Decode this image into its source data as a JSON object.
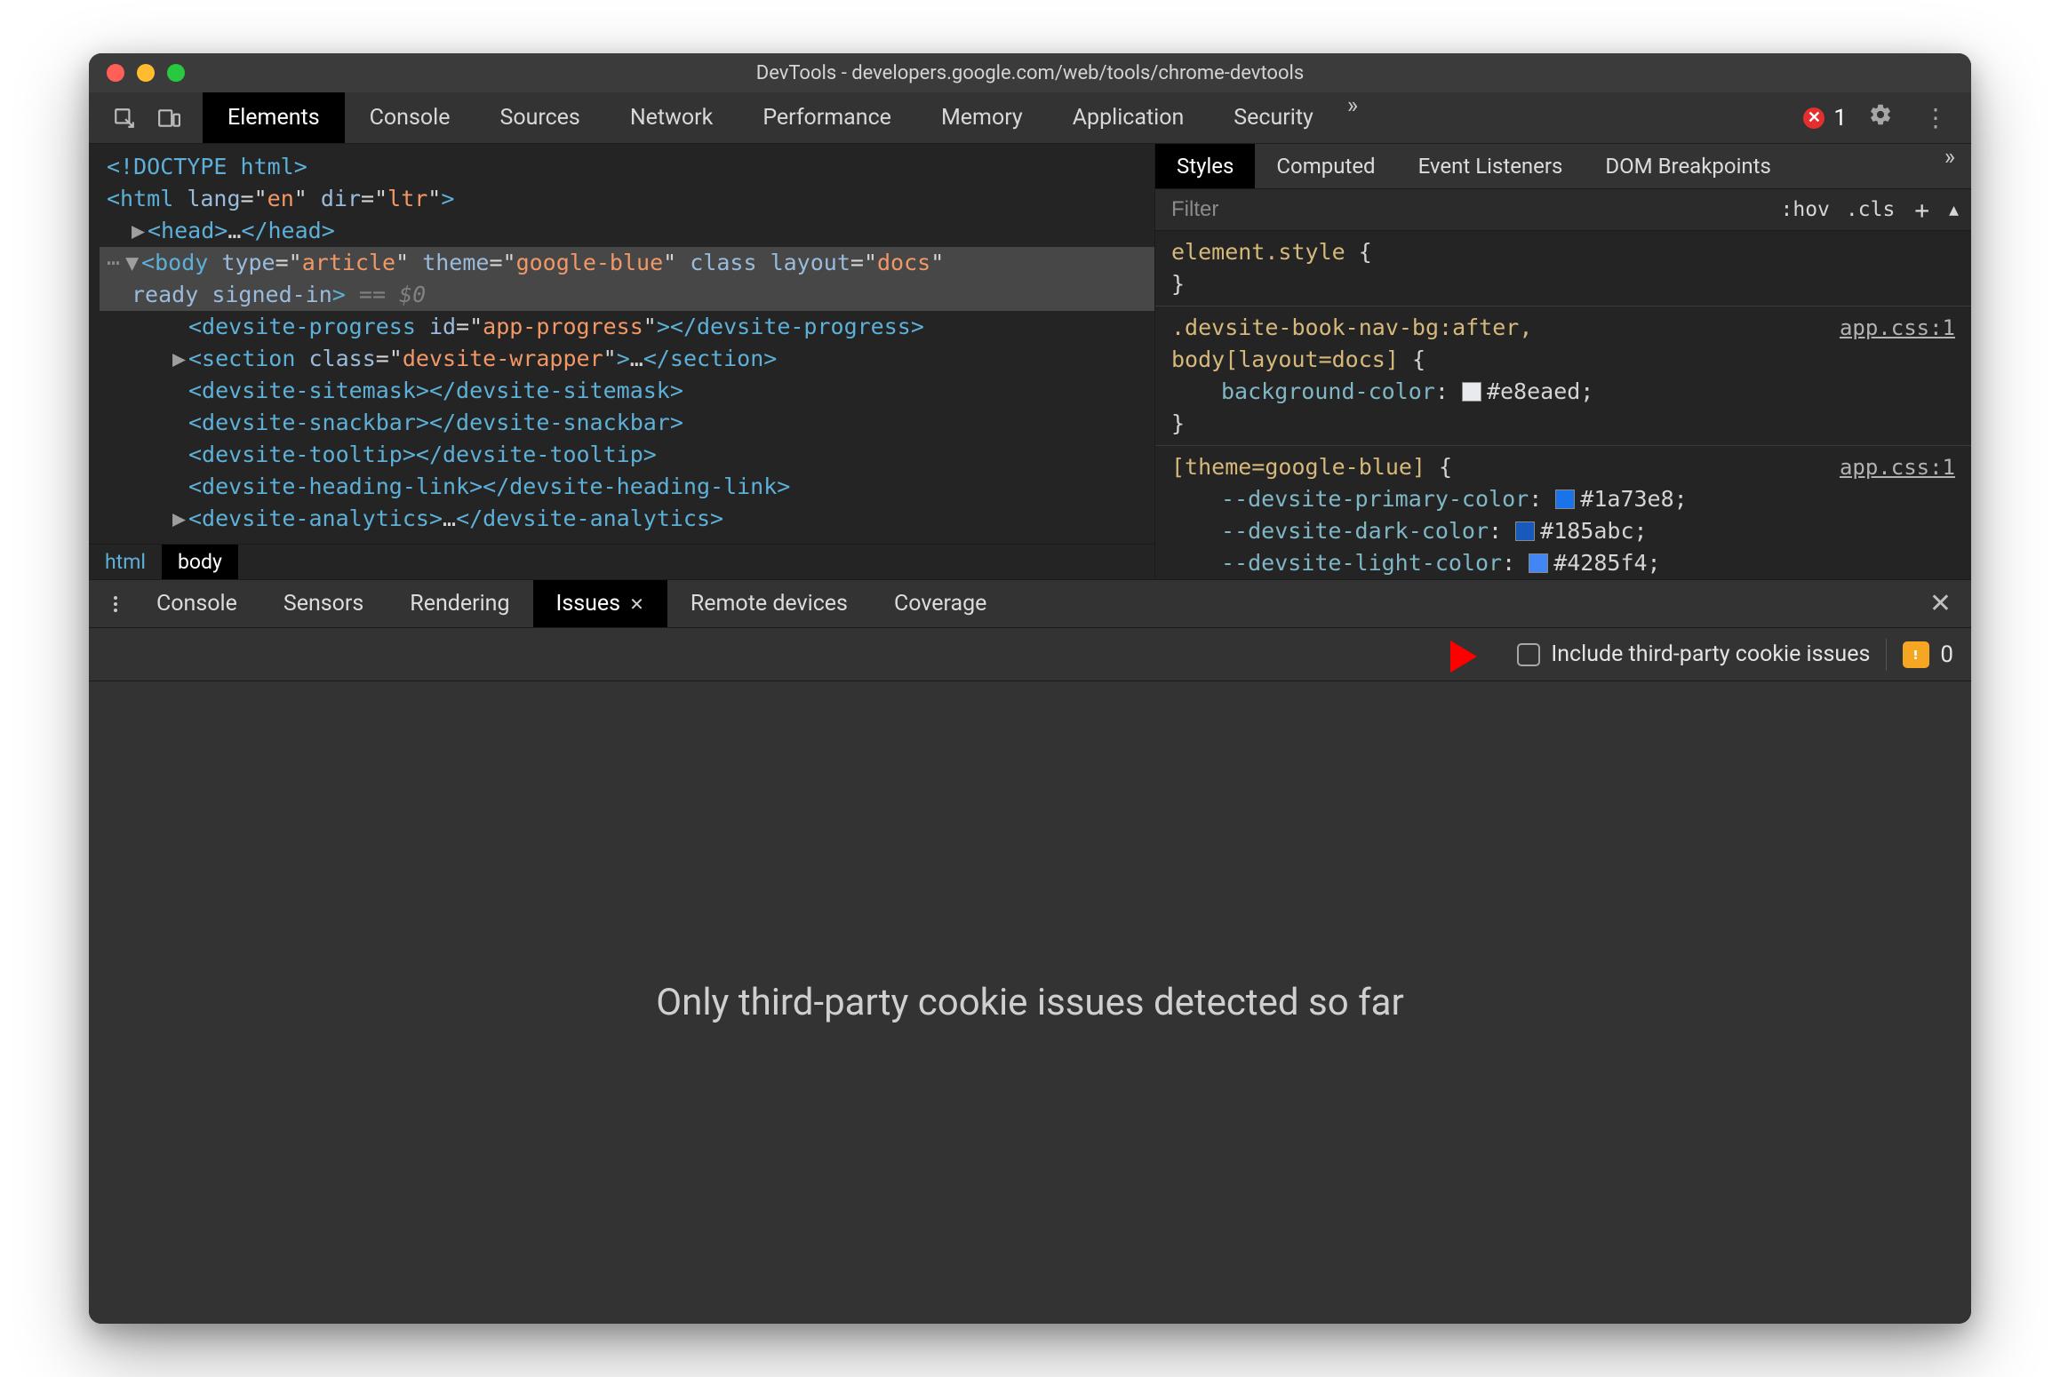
{
  "titlebar": {
    "title": "DevTools - developers.google.com/web/tools/chrome-devtools"
  },
  "main_tabs": {
    "items": [
      "Elements",
      "Console",
      "Sources",
      "Network",
      "Performance",
      "Memory",
      "Application",
      "Security"
    ],
    "active": "Elements",
    "error_count": "1"
  },
  "dom": {
    "lines": [
      {
        "indent": 0,
        "arrow": "",
        "html": "<!DOCTYPE html>"
      },
      {
        "indent": 0,
        "arrow": "",
        "html": "<html lang=\"en\" dir=\"ltr\">"
      },
      {
        "indent": 1,
        "arrow": "▶",
        "html": "<head>…</head>"
      },
      {
        "indent": 0,
        "arrow": "▼",
        "selected": true,
        "pre": "⋯",
        "html": "<body type=\"article\" theme=\"google-blue\" class layout=\"docs\""
      },
      {
        "indent": 0,
        "arrow": "",
        "selected": true,
        "continuation": true,
        "html": "ready signed-in> == $0"
      },
      {
        "indent": 2,
        "arrow": "",
        "html": "<devsite-progress id=\"app-progress\"></devsite-progress>"
      },
      {
        "indent": 2,
        "arrow": "▶",
        "html": "<section class=\"devsite-wrapper\">…</section>"
      },
      {
        "indent": 2,
        "arrow": "",
        "html": "<devsite-sitemask></devsite-sitemask>"
      },
      {
        "indent": 2,
        "arrow": "",
        "html": "<devsite-snackbar></devsite-snackbar>"
      },
      {
        "indent": 2,
        "arrow": "",
        "html": "<devsite-tooltip></devsite-tooltip>"
      },
      {
        "indent": 2,
        "arrow": "",
        "html": "<devsite-heading-link></devsite-heading-link>"
      },
      {
        "indent": 2,
        "arrow": "▶",
        "html": "<devsite-analytics>…</devsite-analytics>"
      }
    ],
    "breadcrumb": [
      "html",
      "body"
    ],
    "breadcrumb_active": "body"
  },
  "styles_tabs": {
    "items": [
      "Styles",
      "Computed",
      "Event Listeners",
      "DOM Breakpoints"
    ],
    "active": "Styles"
  },
  "filter": {
    "placeholder": "Filter",
    "hov": ":hov",
    "cls": ".cls",
    "plus": "+"
  },
  "css_rules": [
    {
      "selector": "element.style {",
      "end": "}",
      "props": [],
      "link": ""
    },
    {
      "selector": ".devsite-book-nav-bg:after,\nbody[layout=docs] {",
      "end": "}",
      "link": "app.css:1",
      "props": [
        {
          "prop": "background-color",
          "swatch": "#e8eaed",
          "val": "#e8eaed;"
        }
      ]
    },
    {
      "selector": "[theme=google-blue] {",
      "end": "",
      "link": "app.css:1",
      "props": [
        {
          "prop": "--devsite-primary-color",
          "swatch": "#1a73e8",
          "val": "#1a73e8;"
        },
        {
          "prop": "--devsite-dark-color",
          "swatch": "#185abc",
          "val": "#185abc;"
        },
        {
          "prop": "--devsite-light-color",
          "swatch": "#4285f4",
          "val": "#4285f4;"
        }
      ]
    }
  ],
  "drawer": {
    "tabs": [
      "Console",
      "Sensors",
      "Rendering",
      "Issues",
      "Remote devices",
      "Coverage"
    ],
    "active": "Issues",
    "checkbox_label": "Include third-party cookie issues",
    "issue_count": "0",
    "body_message": "Only third-party cookie issues detected so far"
  }
}
